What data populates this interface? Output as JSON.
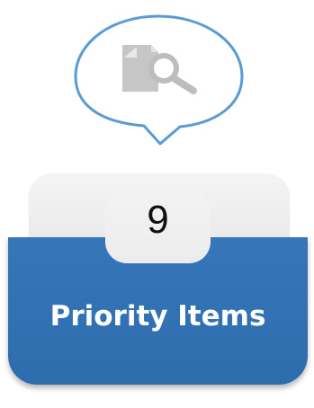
{
  "bubble": {
    "icon": "document-search-icon",
    "stroke_color": "#5b9bd5",
    "icon_color": "#c8c8c8"
  },
  "card": {
    "count": "9",
    "label": "Priority Items",
    "accent_color": "#2f70b1",
    "tab_color": "#efefef"
  }
}
